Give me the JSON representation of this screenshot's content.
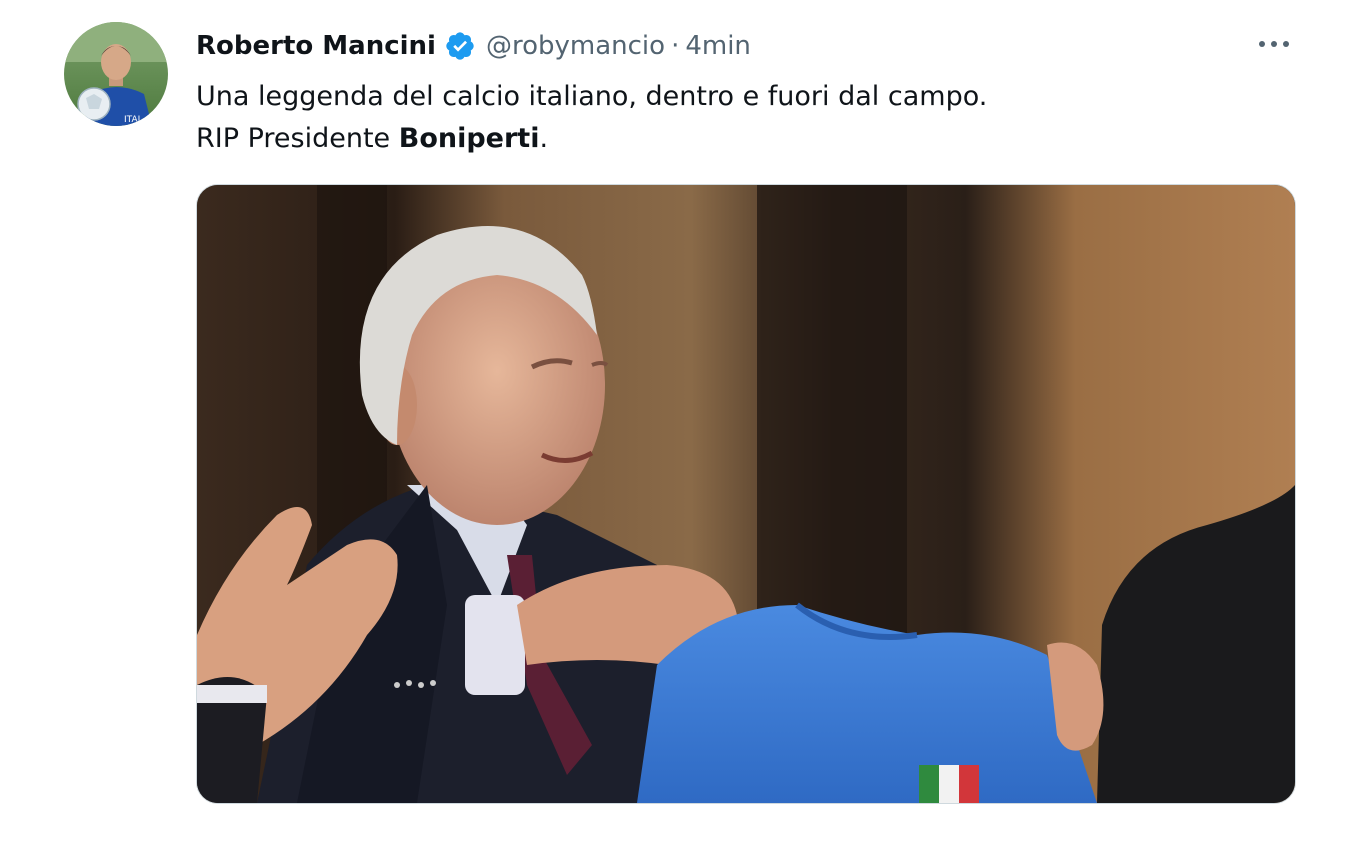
{
  "tweet": {
    "author_name": "Roberto Mancini",
    "handle": "@robymancio",
    "separator": "·",
    "time": "4min",
    "text_line1": "Una leggenda del calcio italiano, dentro e fuori dal campo.",
    "text_line2_prefix": "RIP Presidente ",
    "text_line2_bold": "Boniperti",
    "text_line2_suffix": ".",
    "verified_badge_icon": "verified-checkmark-icon",
    "more_icon": "more-horizontal-icon",
    "media_description_icon": "tweet-photo"
  },
  "colors": {
    "verified_blue": "#1d9bf0",
    "text_primary": "#0f1419",
    "text_secondary": "#536471",
    "shirt_blue": "#3b7fd9"
  }
}
